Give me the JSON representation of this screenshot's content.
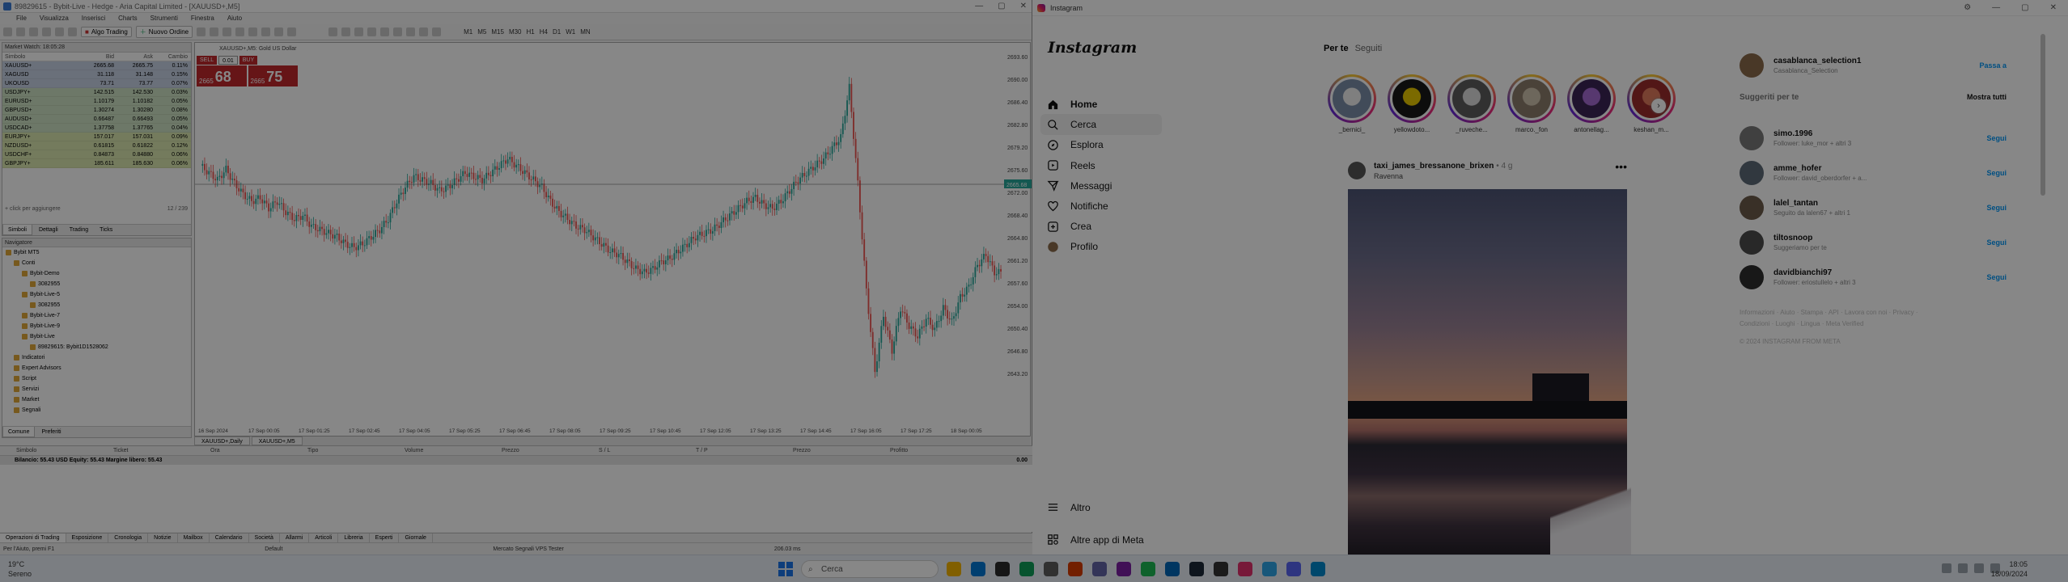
{
  "mt5": {
    "window_title": "89829615 - Bybit-Live - Hedge - Aria Capital Limited - [XAUUSD+,M5]",
    "menu": [
      "File",
      "Visualizza",
      "Inserisci",
      "Charts",
      "Strumenti",
      "Finestra",
      "Aiuto"
    ],
    "toolbar": {
      "algo_label": "Algo Trading",
      "new_order_label": "Nuovo Ordine",
      "timeframes": [
        "M1",
        "M5",
        "M15",
        "M30",
        "H1",
        "H4",
        "D1",
        "W1",
        "MN"
      ]
    },
    "market_watch": {
      "title": "Market Watch: 18:05:28",
      "headers": [
        "Simbolo",
        "Bid",
        "Ask",
        "Cambio"
      ],
      "rows": [
        {
          "symbol": "XAUUSD+",
          "bid": "2665.68",
          "ask": "2665.75",
          "chg": "0.11%",
          "color": "#c9d3e6"
        },
        {
          "symbol": "XAGUSD",
          "bid": "31.118",
          "ask": "31.148",
          "chg": "0.15%",
          "color": "#c9d3e6"
        },
        {
          "symbol": "UKOUSD",
          "bid": "73.71",
          "ask": "73.77",
          "chg": "0.07%",
          "color": "#c9d3e6"
        },
        {
          "symbol": "USDJPY+",
          "bid": "142.515",
          "ask": "142.530",
          "chg": "0.03%",
          "color": "#cfe3c4"
        },
        {
          "symbol": "EURUSD+",
          "bid": "1.10179",
          "ask": "1.10182",
          "chg": "0.05%",
          "color": "#cfe3c4"
        },
        {
          "symbol": "GBPUSD+",
          "bid": "1.30274",
          "ask": "1.30280",
          "chg": "0.08%",
          "color": "#cfe3c4"
        },
        {
          "symbol": "AUDUSD+",
          "bid": "0.66487",
          "ask": "0.66493",
          "chg": "0.05%",
          "color": "#cfe3c4"
        },
        {
          "symbol": "USDCAD+",
          "bid": "1.37758",
          "ask": "1.37765",
          "chg": "0.04%",
          "color": "#cfe3c4"
        },
        {
          "symbol": "EURJPY+",
          "bid": "157.017",
          "ask": "157.031",
          "chg": "0.09%",
          "color": "#dbe8b0"
        },
        {
          "symbol": "NZDUSD+",
          "bid": "0.61815",
          "ask": "0.61822",
          "chg": "0.12%",
          "color": "#dbe8b0"
        },
        {
          "symbol": "USDCHF+",
          "bid": "0.84873",
          "ask": "0.84880",
          "chg": "0.06%",
          "color": "#dbe8b0"
        },
        {
          "symbol": "GBPJPY+",
          "bid": "185.611",
          "ask": "185.630",
          "chg": "0.06%",
          "color": "#dbe8b0"
        }
      ],
      "add_label": "+ click per aggiungere",
      "count_label": "12 / 239",
      "tabs": [
        "Simboli",
        "Dettagli",
        "Trading",
        "Ticks"
      ]
    },
    "navigator": {
      "title": "Navigatore",
      "items": [
        {
          "label": "Bybit MT5",
          "indent": 0
        },
        {
          "label": "Conti",
          "indent": 1
        },
        {
          "label": "Bybit-Demo",
          "indent": 2
        },
        {
          "label": "3082955",
          "indent": 3
        },
        {
          "label": "Bybit-Live-5",
          "indent": 2
        },
        {
          "label": "3082955",
          "indent": 3
        },
        {
          "label": "Bybit-Live-7",
          "indent": 2
        },
        {
          "label": "Bybit-Live-9",
          "indent": 2
        },
        {
          "label": "Bybit-Live",
          "indent": 2
        },
        {
          "label": "89829615: Bybit1D1528062",
          "indent": 3
        },
        {
          "label": "Indicatori",
          "indent": 1
        },
        {
          "label": "Expert Advisors",
          "indent": 1
        },
        {
          "label": "Script",
          "indent": 1
        },
        {
          "label": "Servizi",
          "indent": 1
        },
        {
          "label": "Market",
          "indent": 1
        },
        {
          "label": "Segnali",
          "indent": 1
        }
      ],
      "tabs": [
        "Comune",
        "Preferiti"
      ]
    },
    "chart": {
      "info": "XAUUSD+,M5: Gold US Dollar",
      "order_panel": {
        "sell_label": "SELL",
        "buy_label": "BUY",
        "lot": "0.01",
        "sell_small": "2665",
        "sell_big": "68",
        "buy_small": "2665",
        "buy_big": "75"
      },
      "current_price": "2665.68",
      "price_labels": [
        "2693.60",
        "2690.00",
        "2686.40",
        "2682.80",
        "2679.20",
        "2675.60",
        "2672.00",
        "2668.40",
        "2664.80",
        "2661.20",
        "2657.60",
        "2654.00",
        "2650.40",
        "2646.80",
        "2643.20"
      ],
      "time_labels": [
        "16 Sep 2024",
        "17 Sep 00:05",
        "17 Sep 01:25",
        "17 Sep 02:45",
        "17 Sep 04:05",
        "17 Sep 05:25",
        "17 Sep 06:45",
        "17 Sep 08:05",
        "17 Sep 09:25",
        "17 Sep 10:45",
        "17 Sep 12:05",
        "17 Sep 13:25",
        "17 Sep 14:45",
        "17 Sep 16:05",
        "17 Sep 17:25",
        "18 Sep 00:05"
      ],
      "tabs": [
        "XAUUSD+,Daily",
        "XAUUSD+,M5"
      ]
    },
    "toolbox": {
      "headers": [
        "Simbolo",
        "Ticket",
        "Ora",
        "Tipo",
        "Volume",
        "Prezzo",
        "S / L",
        "T / P",
        "Prezzo",
        "Profitto"
      ],
      "balance_row": "Bilancio: 55.43 USD  Equity: 55.43  Margine libero: 55.43",
      "balance_value": "0.00",
      "tabs": [
        "Operazioni di Trading",
        "Esposizione",
        "Cronologia",
        "Notizie",
        "Mailbox",
        "Calendario",
        "Società",
        "Allarmi",
        "Articoli",
        "Libreria",
        "Esperti",
        "Giornale"
      ]
    },
    "status": {
      "help": "Per l'Aiuto, premi F1",
      "profile": "Default",
      "right": "Mercato  Segnali  VPS  Tester",
      "ping": "206.03 ms"
    }
  },
  "instagram": {
    "window_title": "Instagram",
    "logo": "Instagram",
    "nav": [
      {
        "label": "Home",
        "icon": "home-icon",
        "bold": true
      },
      {
        "label": "Cerca",
        "icon": "search-icon"
      },
      {
        "label": "Esplora",
        "icon": "compass-icon"
      },
      {
        "label": "Reels",
        "icon": "reels-icon"
      },
      {
        "label": "Messaggi",
        "icon": "send-icon"
      },
      {
        "label": "Notifiche",
        "icon": "heart-icon"
      },
      {
        "label": "Crea",
        "icon": "plus-icon"
      },
      {
        "label": "Profilo",
        "icon": "avatar-icon"
      }
    ],
    "bottom_nav": [
      {
        "label": "Altro",
        "icon": "menu-icon"
      },
      {
        "label": "Altre app di Meta",
        "icon": "meta-icon"
      }
    ],
    "feed_tabs": {
      "for_you": "Per te",
      "following": "Seguiti"
    },
    "stories": [
      {
        "name": "_bernici_",
        "c1": "#7b8ea8",
        "c2": "#f0f0f0"
      },
      {
        "name": "yellowdoto...",
        "c1": "#1a1a1a",
        "c2": "#e8c900"
      },
      {
        "name": "_ruveche...",
        "c1": "#5d5d5d",
        "c2": "#ddd"
      },
      {
        "name": "marco._fon",
        "c1": "#8c7d6c",
        "c2": "#cfc2ae"
      },
      {
        "name": "antonellag...",
        "c1": "#3b2456",
        "c2": "#a46bd1"
      },
      {
        "name": "keshan_m...",
        "c1": "#9b2d2d",
        "c2": "#e07c5e"
      }
    ],
    "post": {
      "user": "taxi_james_bressanone_brixen",
      "time": "• 4 g",
      "location": "Ravenna",
      "more": "•••"
    },
    "me": {
      "user": "casablanca_selection1",
      "sub": "Casablanca_Selection",
      "action": "Passa a"
    },
    "suggestions_title": "Suggeriti per te",
    "show_all": "Mostra tutti",
    "follow_label": "Segui",
    "suggestions": [
      {
        "user": "simo.1996",
        "sub": "Follower: luke_mor + altri 3"
      },
      {
        "user": "amme_hofer",
        "sub": "Follower: david_oberdorfer + a..."
      },
      {
        "user": "lalel_tantan",
        "sub": "Seguito da lalen67 + altri 1"
      },
      {
        "user": "tiltosnoop",
        "sub": "Suggeriamo per te"
      },
      {
        "user": "davidbianchi97",
        "sub": "Follower: eriostullelo + altri 3"
      }
    ],
    "footer": "Informazioni · Aiuto · Stampa · API · Lavora con noi · Privacy · Condizioni · Luoghi · Lingua · Meta Verified",
    "copyright": "© 2024 INSTAGRAM FROM META"
  },
  "taskbar": {
    "weather_temp": "19°C",
    "weather_desc": "Sereno",
    "search_placeholder": "Cerca",
    "time": "18:05",
    "date": "18/09/2024",
    "apps": [
      "#f4b400",
      "#0078d4",
      "#2b2b2b",
      "#0f9d58",
      "#5e5e5e",
      "#d83b01",
      "#6264a7",
      "#7b1fa2",
      "#1db954",
      "#0067b8",
      "#1b2838",
      "#333333",
      "#e1306c",
      "#2fa4e7",
      "#5865f2",
      "#0088cc"
    ]
  },
  "colors": {
    "candle_up": "#26a69a",
    "candle_down": "#ef5350",
    "sell_red": "#c0282d",
    "ig_blue": "#0095f6"
  }
}
